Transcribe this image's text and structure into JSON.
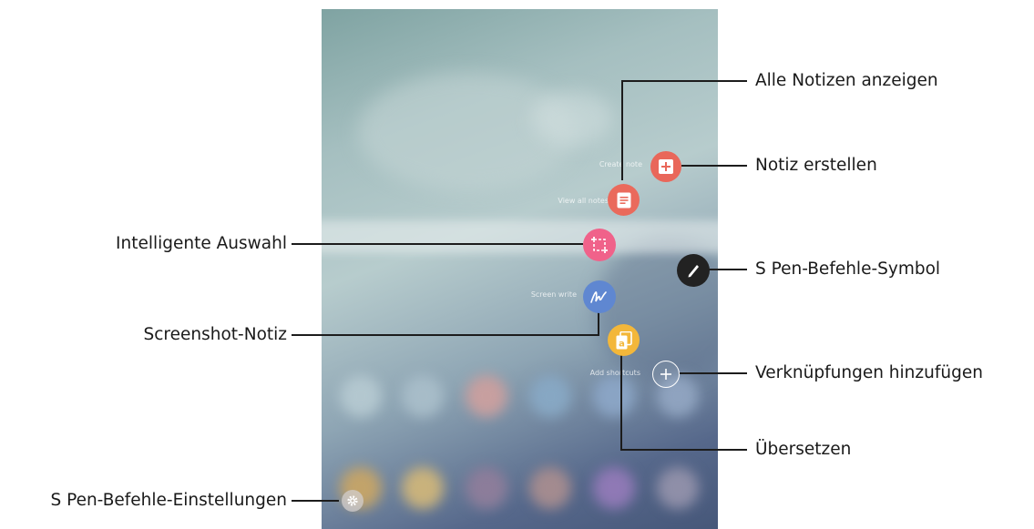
{
  "callouts": {
    "view_all_notes": "Alle Notizen anzeigen",
    "create_note": "Notiz erstellen",
    "smart_select": "Intelligente Auswahl",
    "air_command_icon": "S Pen-Befehle-Symbol",
    "screen_write": "Screenshot-Notiz",
    "add_shortcuts": "Verknüpfungen hinzufügen",
    "translate": "Übersetzen",
    "air_command_settings": "S Pen-Befehle-Einstellungen"
  },
  "menu_items": {
    "create_note": "Create note",
    "view_all_notes": "View all notes",
    "screen_write": "Screen write",
    "add_shortcuts": "Add shortcuts"
  },
  "icons": {
    "create_note": "note-plus-icon",
    "view_all_notes": "notes-list-icon",
    "smart_select": "crop-select-icon",
    "screen_write": "handwriting-icon",
    "translate": "translate-icon",
    "air_command": "pen-icon",
    "add_shortcuts": "plus-icon",
    "settings": "gear-icon"
  },
  "colors": {
    "create_note": "#e9675a",
    "view_all_notes": "#ea6a5c",
    "smart_select": "#f0628a",
    "screen_write": "#5f87d1",
    "translate": "#f3b73a",
    "air_command": "#222222",
    "callout_line": "#1c1c1c"
  }
}
